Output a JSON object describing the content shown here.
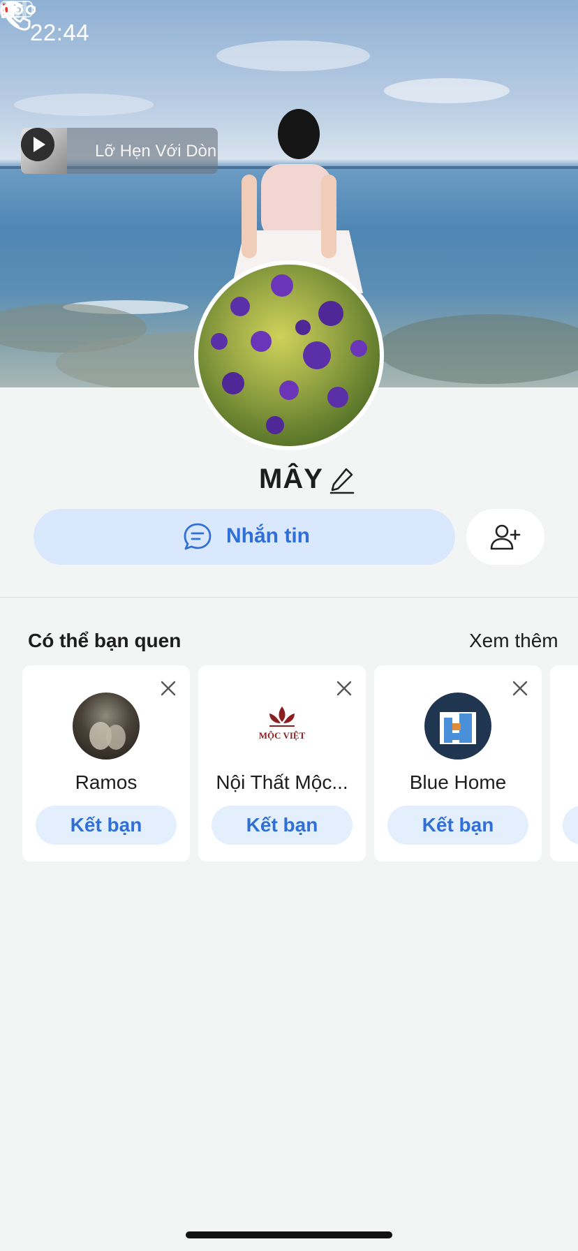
{
  "status_bar": {
    "time": "22:44"
  },
  "profile": {
    "music_title": "Lỡ Hẹn Với Dòn",
    "name": "MÂY",
    "message_label": "Nhắn tin"
  },
  "suggestions": {
    "title": "Có thể bạn quen",
    "see_more": "Xem thêm",
    "items": [
      {
        "name": "Ramos",
        "action": "Kết bạn"
      },
      {
        "name": "Nội Thất Mộc...",
        "action": "Kết bạn",
        "logo_text": "MỘC VIỆT"
      },
      {
        "name": "Blue Home",
        "action": "Kết bạn"
      }
    ]
  },
  "colors": {
    "accent": "#2f6fd6",
    "button_bg": "#d9e8fd",
    "page_bg": "#f3f4f4"
  }
}
